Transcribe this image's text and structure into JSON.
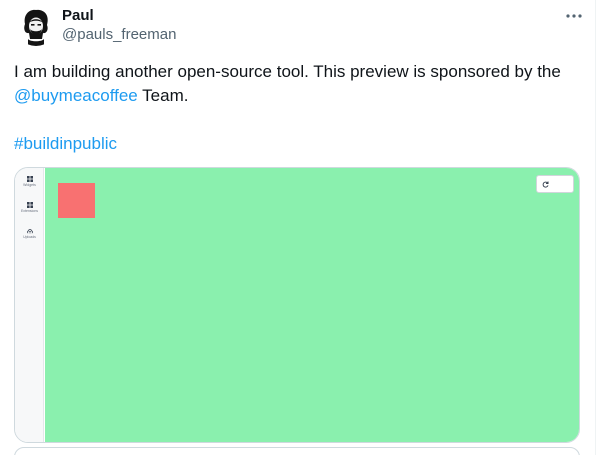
{
  "author": {
    "display_name": "Paul",
    "handle": "@pauls_freeman"
  },
  "tweet": {
    "text_before": "I am building another open-source tool. This preview is sponsored by the ",
    "mention": "@buymeacoffee",
    "text_after": " Team.",
    "hashtag": "#buildinpublic"
  },
  "preview": {
    "sidebar": [
      {
        "label": "Widgets",
        "icon": "widgets-icon"
      },
      {
        "label": "Extensions",
        "icon": "extensions-icon"
      },
      {
        "label": "Uploads",
        "icon": "cloud-upload-icon"
      }
    ],
    "colors": {
      "canvas": "#8af0ae",
      "block": "#f87171"
    }
  },
  "colors": {
    "link": "#1d9bf0",
    "text": "#0f1419",
    "muted": "#536471"
  }
}
